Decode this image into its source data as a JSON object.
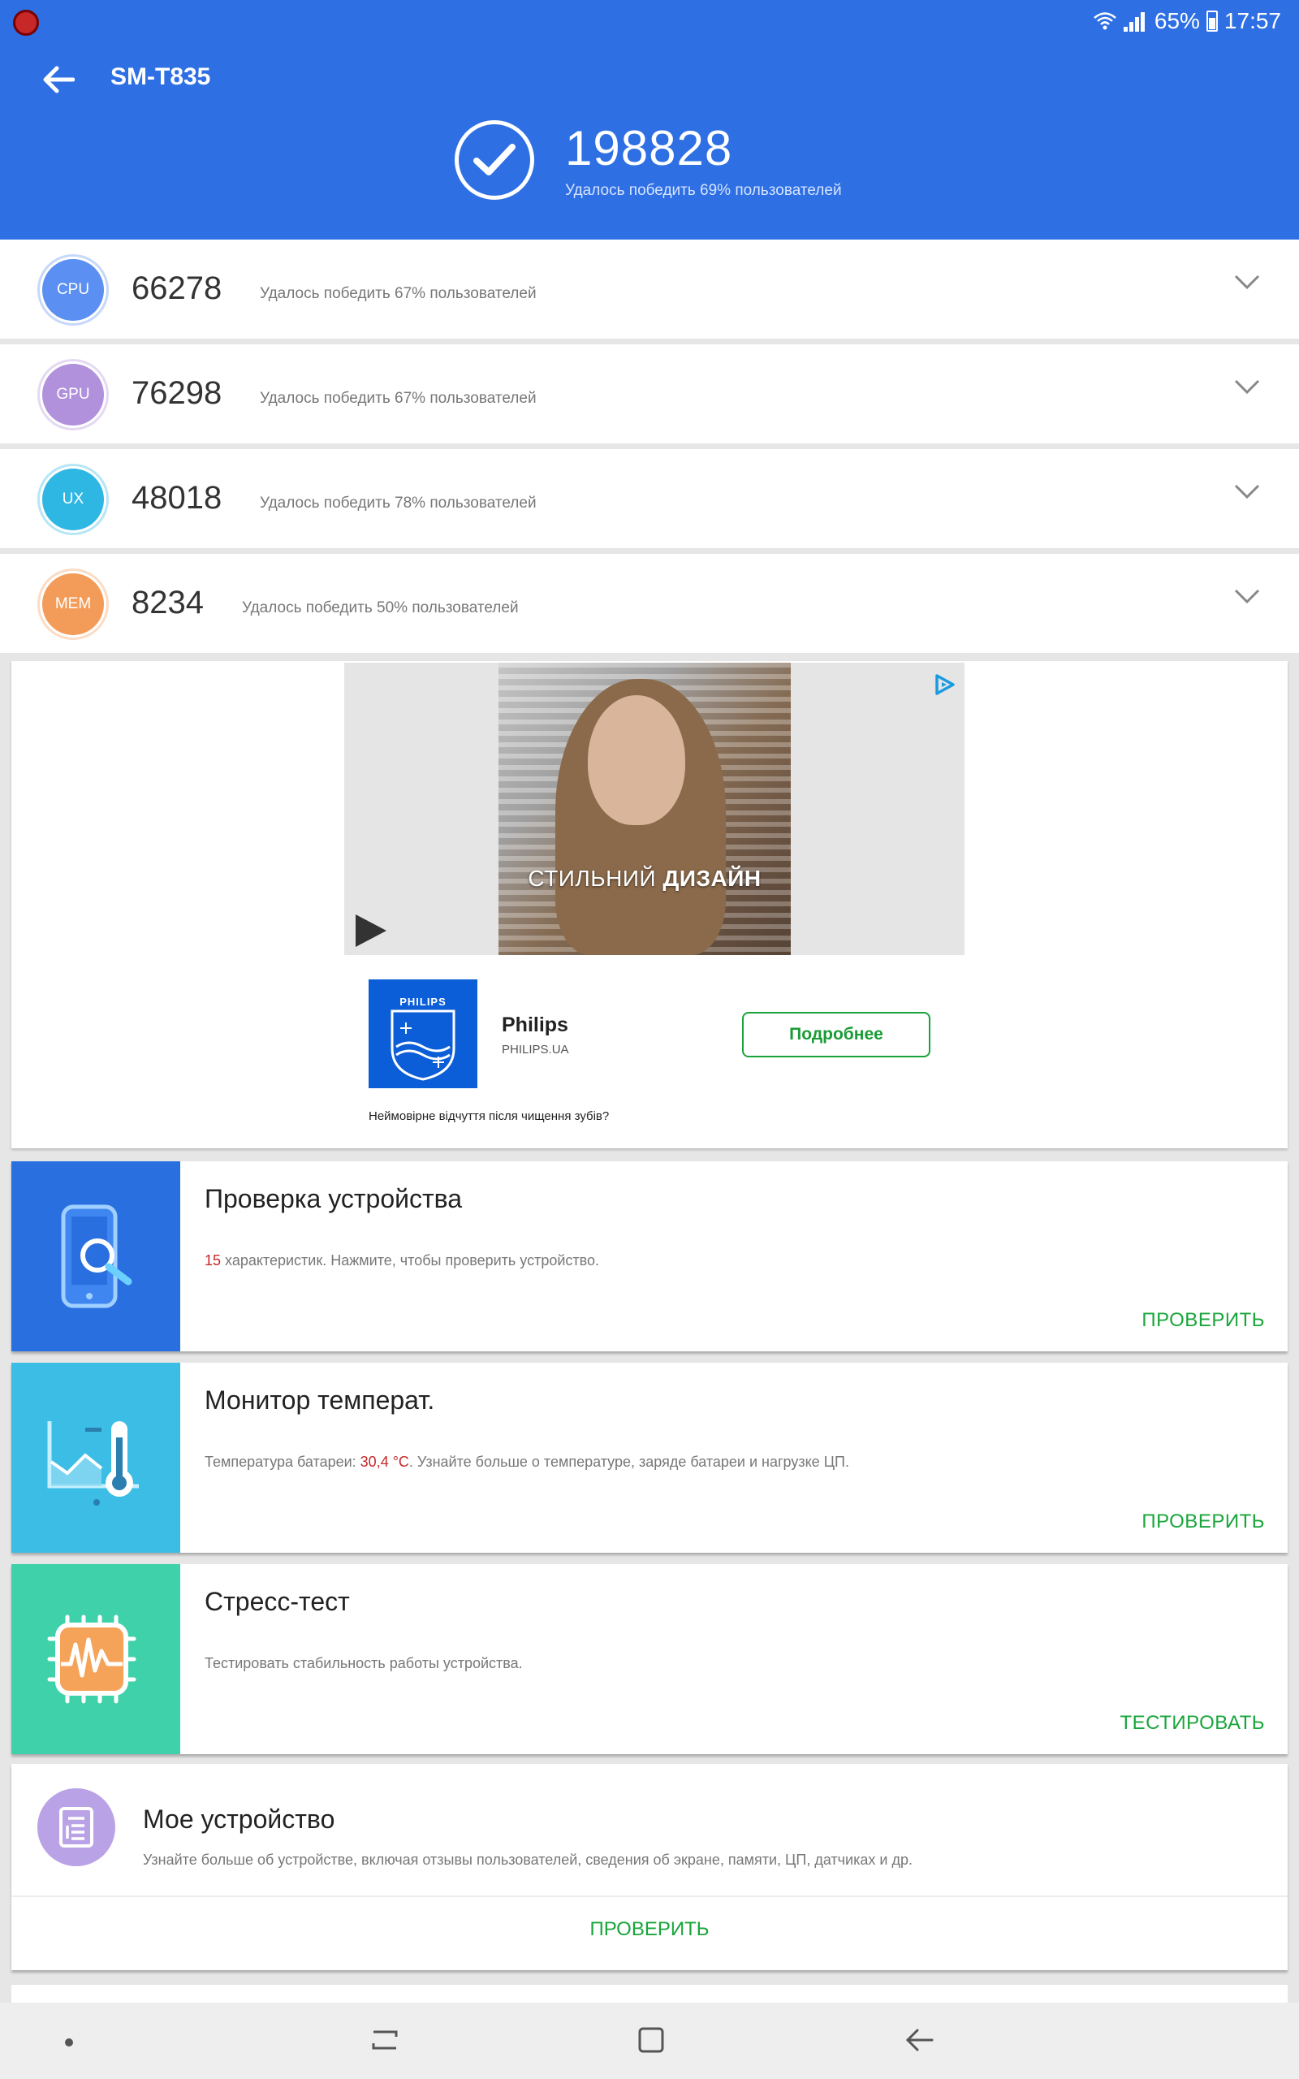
{
  "status_bar": {
    "battery": "65%",
    "time": "17:57"
  },
  "header": {
    "title": "SM-T835",
    "total_score": "198828",
    "total_subtitle": "Удалось победить 69% пользователей"
  },
  "scores": [
    {
      "badge": "CPU",
      "value": "66278",
      "desc": "Удалось победить 67% пользователей",
      "color": "#5b8ff2"
    },
    {
      "badge": "GPU",
      "value": "76298",
      "desc": "Удалось победить 67% пользователей",
      "color": "#b191db"
    },
    {
      "badge": "UX",
      "value": "48018",
      "desc": "Удалось победить 78% пользователей",
      "color": "#2fb7e3"
    },
    {
      "badge": "MEM",
      "value": "8234",
      "desc": "Удалось победить 50% пользователей",
      "color": "#f39c5a"
    }
  ],
  "ad": {
    "caption_light": "СТИЛЬНИЙ ",
    "caption_bold": "ДИЗАЙН",
    "logo_text": "PHILIPS",
    "brand": "Philips",
    "domain": "PHILIPS.UA",
    "cta": "Подробнее",
    "text": "Неймовірне відчуття після чищення зубів?"
  },
  "features": [
    {
      "title": "Проверка устройства",
      "desc_hl": "15",
      "desc": " характеристик. Нажмите, чтобы проверить устройство.",
      "action": "ПРОВЕРИТЬ",
      "color": "#2a6fe0"
    },
    {
      "title": "Монитор температ.",
      "desc_pre": "Температура батареи: ",
      "desc_hl": "30,4 °C",
      "desc": ". Узнайте больше о температуре, заряде батареи и нагрузке ЦП.",
      "action": "ПРОВЕРИТЬ",
      "color": "#3bbde6"
    },
    {
      "title": "Стресс-тест",
      "desc": "Тестировать стабильность работы устройства.",
      "action": "ТЕСТИРОВАТЬ",
      "color": "#3fd1a9"
    }
  ],
  "my_device": {
    "title": "Мое устройство",
    "desc": "Узнайте больше об устройстве, включая отзывы пользователей, сведения об экране, памяти, ЦП, датчиках и др.",
    "action": "ПРОВЕРИТЬ"
  }
}
